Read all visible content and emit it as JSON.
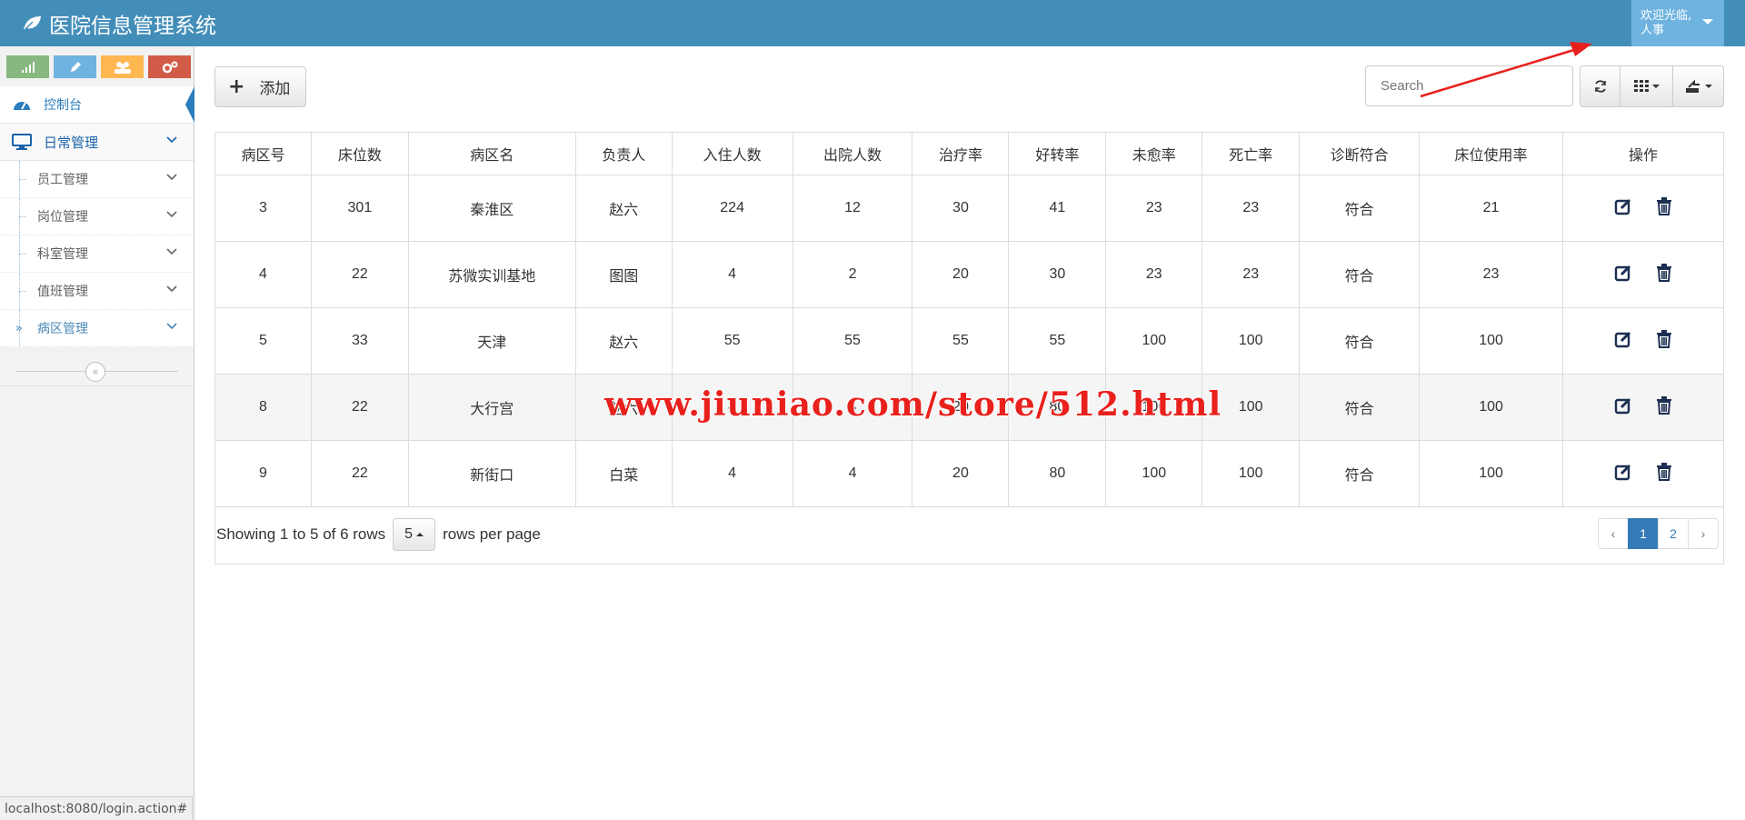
{
  "app": {
    "title": "医院信息管理系统"
  },
  "user": {
    "welcome": "欢迎光临,",
    "name": "人事"
  },
  "sidebar": {
    "items": [
      {
        "label": "控制台",
        "active": true
      },
      {
        "label": "日常管理"
      }
    ],
    "sub_items": [
      {
        "label": "员工管理"
      },
      {
        "label": "岗位管理"
      },
      {
        "label": "科室管理"
      },
      {
        "label": "值班管理"
      },
      {
        "label": "病区管理",
        "current": true
      }
    ]
  },
  "toolbar": {
    "add_label": "添加",
    "search_placeholder": "Search"
  },
  "table": {
    "columns": [
      "病区号",
      "床位数",
      "病区名",
      "负责人",
      "入住人数",
      "出院人数",
      "治疗率",
      "好转率",
      "未愈率",
      "死亡率",
      "诊断符合",
      "床位使用率",
      "操作"
    ],
    "rows": [
      [
        "3",
        "301",
        "秦淮区",
        "赵六",
        "224",
        "12",
        "30",
        "41",
        "23",
        "23",
        "符合",
        "21"
      ],
      [
        "4",
        "22",
        "苏微实训基地",
        "图图",
        "4",
        "2",
        "20",
        "30",
        "23",
        "23",
        "符合",
        "23"
      ],
      [
        "5",
        "33",
        "天津",
        "赵六",
        "55",
        "55",
        "55",
        "55",
        "100",
        "100",
        "符合",
        "100"
      ],
      [
        "8",
        "22",
        "大行宫",
        "赵六",
        "4",
        "4",
        "20",
        "80",
        "100",
        "100",
        "符合",
        "100"
      ],
      [
        "9",
        "22",
        "新街口",
        "白菜",
        "4",
        "4",
        "20",
        "80",
        "100",
        "100",
        "符合",
        "100"
      ]
    ]
  },
  "pager": {
    "showing": "Showing 1 to 5 of 6 rows",
    "page_size": "5",
    "per_page": "rows per page",
    "prev": "‹",
    "pages": [
      "1",
      "2"
    ],
    "next": "›",
    "current_page": "1"
  },
  "watermark": "www.jiuniao.com/store/512.html",
  "statusbar": "localhost:8080/login.action#",
  "colors": {
    "header": "#438eb9",
    "user_menu": "#6fb3e0",
    "accent": "#337ab7",
    "annotation_arrow": "#e8211d"
  }
}
